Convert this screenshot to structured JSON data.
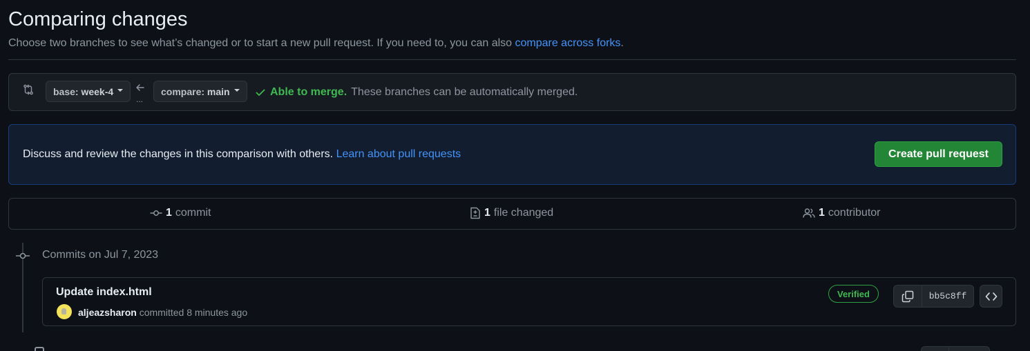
{
  "header": {
    "title": "Comparing changes",
    "subtitle_prefix": "Choose two branches to see what’s changed or to start a new pull request. If you need to, you can also ",
    "subtitle_link": "compare across forks",
    "subtitle_suffix": "."
  },
  "range_editor": {
    "base_label": "base:",
    "base_branch": "week-4",
    "compare_label": "compare:",
    "compare_branch": "main",
    "dots": "...",
    "merge_ok": "Able to merge.",
    "merge_text": "These branches can be automatically merged."
  },
  "discuss": {
    "text": "Discuss and review the changes in this comparison with others.",
    "link": "Learn about pull requests",
    "button": "Create pull request"
  },
  "summary": {
    "commits_count": "1",
    "commits_label": "commit",
    "files_count": "1",
    "files_label": "file changed",
    "contributors_count": "1",
    "contributors_label": "contributor"
  },
  "timeline": {
    "date_heading": "Commits on Jul 7, 2023",
    "commit": {
      "title": "Update index.html",
      "author": "aljeazsharon",
      "action": "committed",
      "time": "8 minutes ago",
      "verified": "Verified",
      "sha": "bb5c8ff"
    }
  },
  "colors": {
    "background": "#0d1117",
    "link": "#4493f8",
    "success": "#3fb950",
    "primary_button": "#238636"
  },
  "icons": [
    "git-compare-icon",
    "arrow-left-icon",
    "check-icon",
    "git-commit-icon",
    "file-diff-icon",
    "people-icon",
    "copy-icon",
    "code-icon",
    "avatar"
  ]
}
